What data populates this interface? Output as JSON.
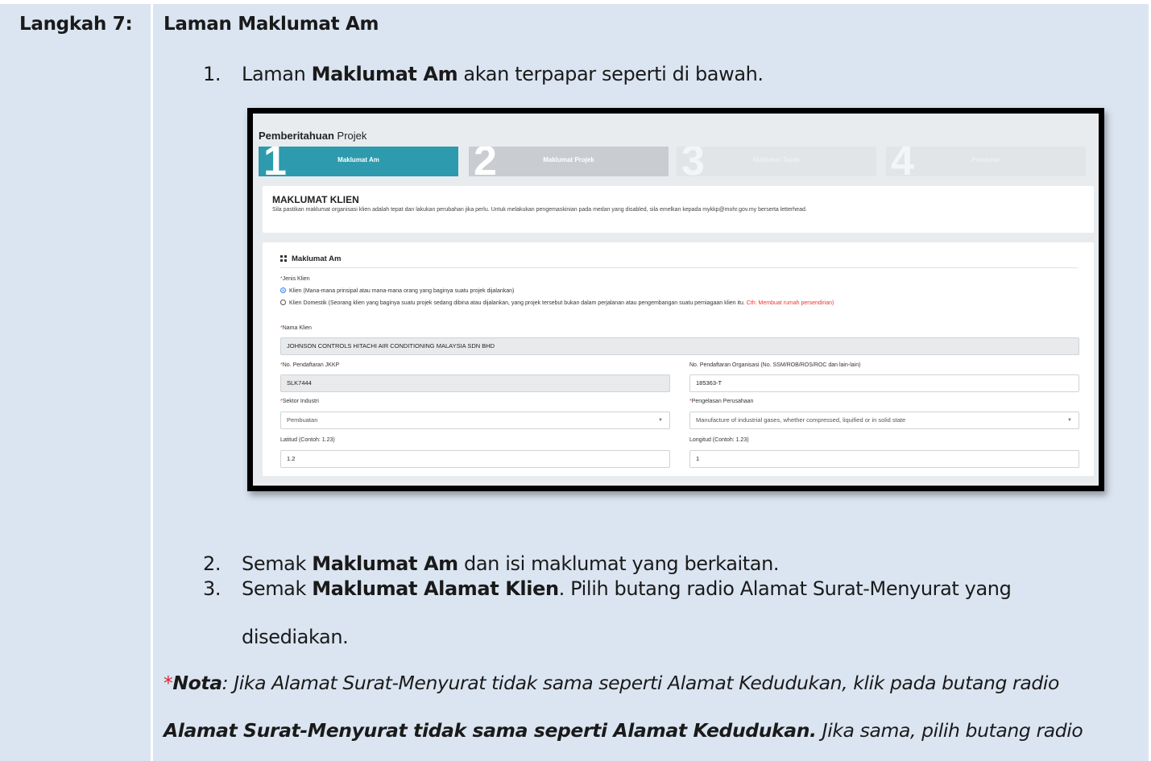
{
  "step": {
    "label": "Langkah 7:",
    "title": "Laman Maklumat Am"
  },
  "items": [
    {
      "num": "1.",
      "pre": "Laman ",
      "bold": "Maklumat Am",
      "post": " akan terpapar seperti di bawah."
    },
    {
      "num": "2.",
      "pre": "Semak ",
      "bold": "Maklumat Am",
      "post": " dan isi maklumat yang berkaitan."
    },
    {
      "num": "3.",
      "pre": "Semak ",
      "bold": "Maklumat Alamat Klien",
      "post": ". Pilih butang radio Alamat Surat-Menyurat yang",
      "cont": "disediakan."
    }
  ],
  "note": {
    "star": "*",
    "label": "Nota",
    "line1": ": Jika Alamat Surat-Menyurat tidak sama seperti Alamat Kedudukan, klik pada butang radio",
    "line2_bold": "Alamat Surat-Menyurat tidak sama seperti Alamat Kedudukan.",
    "line2_rest": " Jika sama, pilih butang radio"
  },
  "screenshot": {
    "title_bold": "Pemberitahuan",
    "title_rest": " Projek",
    "steps": [
      {
        "num": "1",
        "label": "Maklumat Am",
        "state": "active"
      },
      {
        "num": "2",
        "label": "Maklumat Projek",
        "state": "next"
      },
      {
        "num": "3",
        "label": "Maklumat Tapak",
        "state": "disabled"
      },
      {
        "num": "4",
        "label": "Peraturan",
        "state": "disabled"
      }
    ],
    "client_card": {
      "heading": "MAKLUMAT KLIEN",
      "desc": "Sila pastikan maklumat organisasi klien adalah tepat dan lakukan perubahan jika perlu. Untuk melakukan pengemaskinian pada medan yang disabled, sila emelkan kepada mykkp@mohr.gov.my berserta letterhead."
    },
    "section_heading": "Maklumat Am",
    "jenis_klien": {
      "label": "Jenis Klien",
      "option1": "Klien (Mana-mana prinsipal atau mana-mana orang yang baginya suatu projek dijalankan)",
      "option2": "Klien Domestik (Seorang klien yang baginya suatu projek sedang dibina atau dijalankan, yang projek tersebut bukan dalam perjalanan atau pengembangan suatu perniagaan klien itu.",
      "option2_red": " Cth: Membuat rumah persendirian)",
      "selected": "option1"
    },
    "nama_klien": {
      "label": "Nama Klien",
      "value": "JOHNSON CONTROLS HITACHI AIR CONDITIONING MALAYSIA SDN BHD"
    },
    "no_jkkp": {
      "label": "No. Pendaftaran JKKP",
      "value": "SLK7444"
    },
    "no_org": {
      "label": "No. Pendaftaran Organisasi (No. SSM/ROB/ROS/ROC dan lain-lain)",
      "value": "185363-T"
    },
    "sektor": {
      "label": "Sektor Industri",
      "value": "Pembuatan"
    },
    "pengelasan": {
      "label": "Pengelasan Perusahaan",
      "value": "Manufacture of industrial gases, whether compressed, liquified or in solid state"
    },
    "latitud": {
      "label": "Latitud (Contoh: 1.23)",
      "value": "1.2"
    },
    "longitud": {
      "label": "Longitud (Contoh: 1.23)",
      "value": "1"
    },
    "required_mark": "*",
    "caret": "▼"
  }
}
